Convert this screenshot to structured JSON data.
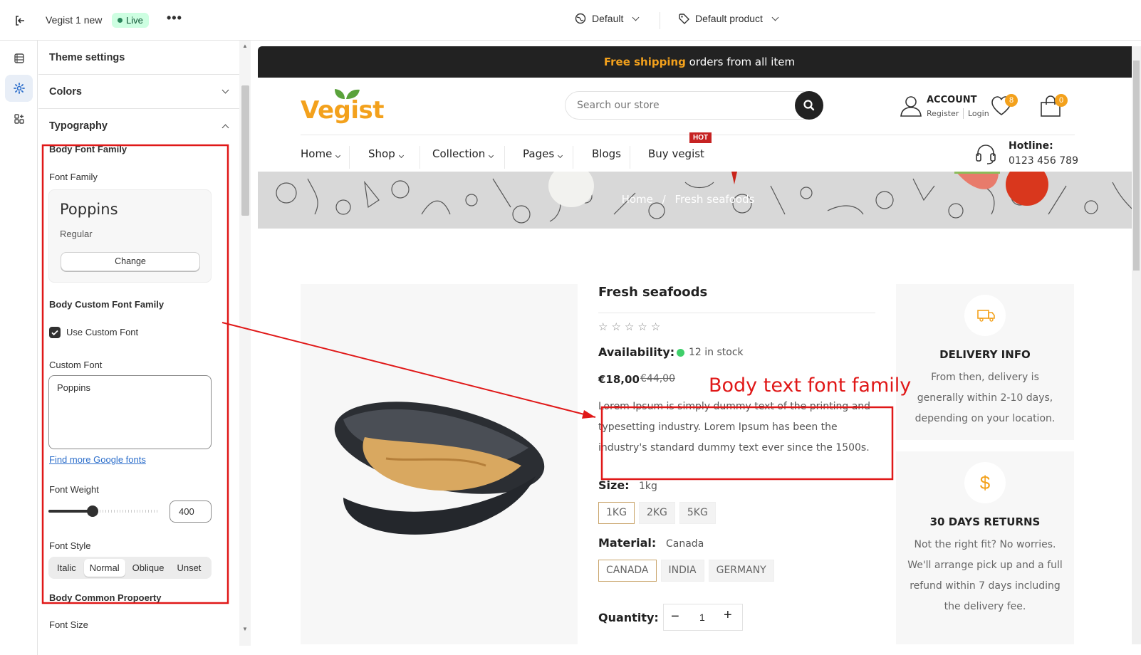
{
  "topbar": {
    "theme_name": "Vegist 1 new",
    "status": "Live",
    "market": "Default",
    "template": "Default product"
  },
  "panel": {
    "theme_settings": "Theme settings",
    "colors": "Colors",
    "typography": "Typography",
    "body_font_family": "Body Font Family",
    "font_family_label": "Font Family",
    "font_name": "Poppins",
    "font_variant": "Regular",
    "change_button": "Change",
    "custom_font_family": "Body Custom Font Family",
    "use_custom_font": "Use Custom Font",
    "use_custom_font_checked": true,
    "custom_font_label": "Custom Font",
    "custom_font_value": "Poppins",
    "google_fonts_link": "Find more Google fonts",
    "font_weight_label": "Font Weight",
    "font_weight_value": "400",
    "font_weight_fraction": 0.4,
    "font_style_label": "Font Style",
    "font_styles": [
      "Italic",
      "Normal",
      "Oblique",
      "Unset"
    ],
    "font_style_selected": "Normal",
    "common_property": "Body Common Propoerty",
    "font_size_label": "Font Size"
  },
  "store": {
    "announce_highlight": "Free shipping",
    "announce_rest": " orders from all item",
    "logo": "Vegist",
    "search_placeholder": "Search our store",
    "account_title": "ACCOUNT",
    "register": "Register",
    "login": "Login",
    "wishlist_count": "8",
    "cart_count": "0",
    "nav": [
      "Home",
      "Shop",
      "Collection",
      "Pages",
      "Blogs",
      "Buy vegist"
    ],
    "hot_badge": "HOT",
    "hotline_label": "Hotline:",
    "hotline_number": "0123 456 789",
    "breadcrumb_home": "Home",
    "breadcrumb_sep": "/",
    "breadcrumb_current": "Fresh seafoods"
  },
  "product": {
    "title": "Fresh seafoods",
    "rating_stars": 0,
    "availability_label": "Availability:",
    "stock": "12 in stock",
    "price": "€18,00",
    "compare_price": "€44,00",
    "description": "Lorem Ipsum is simply dummy text of the printing and typesetting industry. Lorem Ipsum has been the industry's standard dummy text ever since the 1500s.",
    "size_label": "Size:",
    "size_value": "1kg",
    "sizes": [
      "1KG",
      "2KG",
      "5KG"
    ],
    "material_label": "Material:",
    "material_value": "Canada",
    "materials": [
      "CANADA",
      "INDIA",
      "GERMANY"
    ],
    "quantity_label": "Quantity:",
    "quantity": "1"
  },
  "info": {
    "delivery_title": "DELIVERY INFO",
    "delivery_text": "From then, delivery is generally within 2-10 days, depending on your location.",
    "returns_title": "30 DAYS RETURNS",
    "returns_text": "Not the right fit? No worries. We'll arrange pick up and a full refund within 7 days including the delivery fee."
  },
  "annotation": {
    "label": "Body text font family"
  },
  "colors": {
    "accent": "#f3a11c",
    "annotation": "#e01818",
    "admin_blue": "#2c6ecb"
  }
}
